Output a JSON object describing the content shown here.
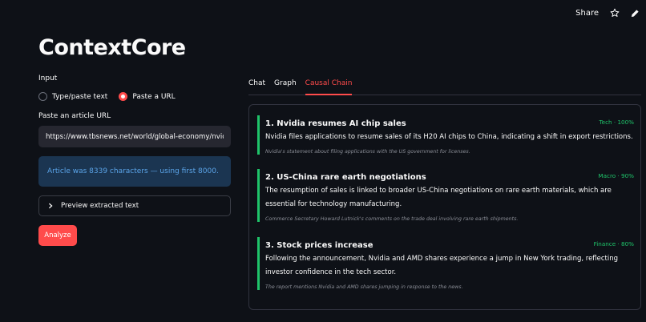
{
  "header": {
    "share_label": "Share",
    "icons": [
      "star-icon",
      "edit-icon"
    ]
  },
  "app": {
    "title": "ContextCore"
  },
  "input": {
    "label": "Input",
    "options": [
      "Type/paste text",
      "Paste a URL"
    ],
    "selected": "Paste a URL",
    "url_label": "Paste an article URL",
    "url_value": "https://www.tbsnews.net/world/global-economy/nvidias"
  },
  "info_message": "Article was 8339 characters — using first 8000.",
  "expander": {
    "label": "Preview extracted text",
    "icon": "chevron-right-icon"
  },
  "analyze_label": "Analyze",
  "tabs": {
    "items": [
      "Chat",
      "Graph",
      "Causal Chain"
    ],
    "active": "Causal Chain"
  },
  "causal_chain": [
    {
      "title": "1. Nvidia resumes AI chip sales",
      "badge": "Tech · 100%",
      "description": "Nvidia files applications to resume sales of its H20 AI chips to China, indicating a shift in export restrictions.",
      "note": "Nvidia's statement about filing applications with the US government for licenses."
    },
    {
      "title": "2. US-China rare earth negotiations",
      "badge": "Macro · 90%",
      "description": "The resumption of sales is linked to broader US-China negotiations on rare earth materials, which are essential for technology manufacturing.",
      "note": "Commerce Secretary Howard Lutnick's comments on the trade deal involving rare earth shipments."
    },
    {
      "title": "3. Stock prices increase",
      "badge": "Finance · 80%",
      "description": "Following the announcement, Nvidia and AMD shares experience a jump in New York trading, reflecting investor confidence in the tech sector.",
      "note": "The report mentions Nvidia and AMD shares jumping in response to the news."
    }
  ],
  "colors": {
    "accent": "#ff4b4b",
    "success": "#1fc46a",
    "info_bg": "#1b3551",
    "info_text": "#5ba4e8"
  }
}
